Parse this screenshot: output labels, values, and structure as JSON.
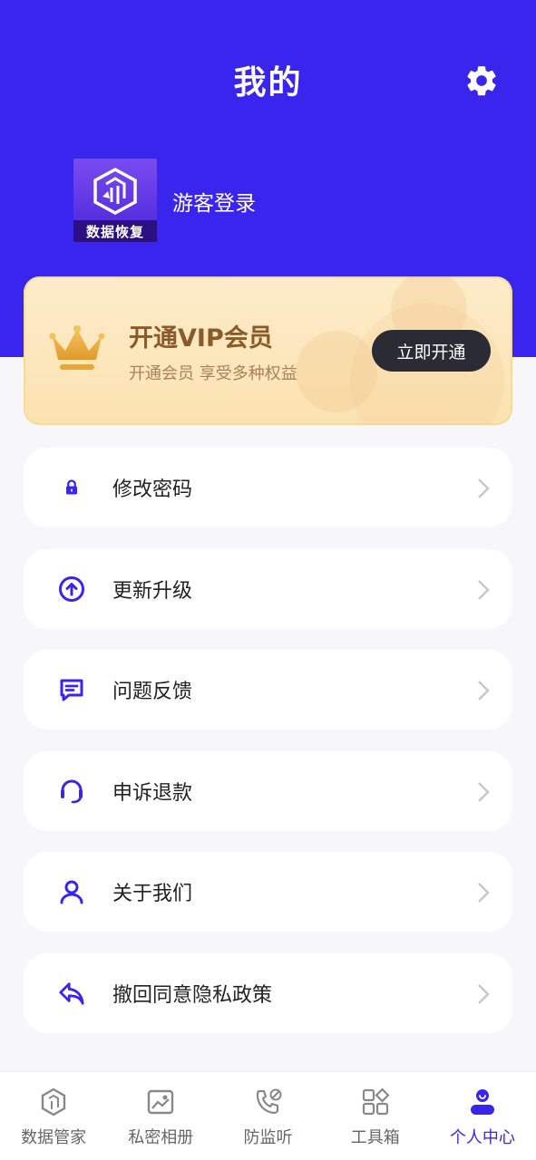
{
  "header": {
    "title": "我的",
    "settings_icon": "gear-icon"
  },
  "profile": {
    "avatar_brand": "数据恢复",
    "login_text": "游客登录"
  },
  "vip": {
    "title": "开通VIP会员",
    "subtitle": "开通会员 享受多种权益",
    "button": "立即开通",
    "icon": "crown-icon"
  },
  "menu": [
    {
      "label": "修改密码",
      "icon": "lock-icon"
    },
    {
      "label": "更新升级",
      "icon": "upload-circle-icon"
    },
    {
      "label": "问题反馈",
      "icon": "feedback-message-icon"
    },
    {
      "label": "申诉退款",
      "icon": "headset-icon"
    },
    {
      "label": "关于我们",
      "icon": "user-icon"
    },
    {
      "label": "撤回同意隐私政策",
      "icon": "reply-icon"
    }
  ],
  "tabs": [
    {
      "label": "数据管家",
      "icon": "data-cube-icon",
      "active": false
    },
    {
      "label": "私密相册",
      "icon": "photo-icon",
      "active": false
    },
    {
      "label": "防监听",
      "icon": "phone-block-icon",
      "active": false
    },
    {
      "label": "工具箱",
      "icon": "grid-tools-icon",
      "active": false
    },
    {
      "label": "个人中心",
      "icon": "person-icon",
      "active": true
    }
  ],
  "colors": {
    "primary": "#3a25ee",
    "vip_gold": "#8a5a28",
    "vip_button": "#2b2b36"
  }
}
